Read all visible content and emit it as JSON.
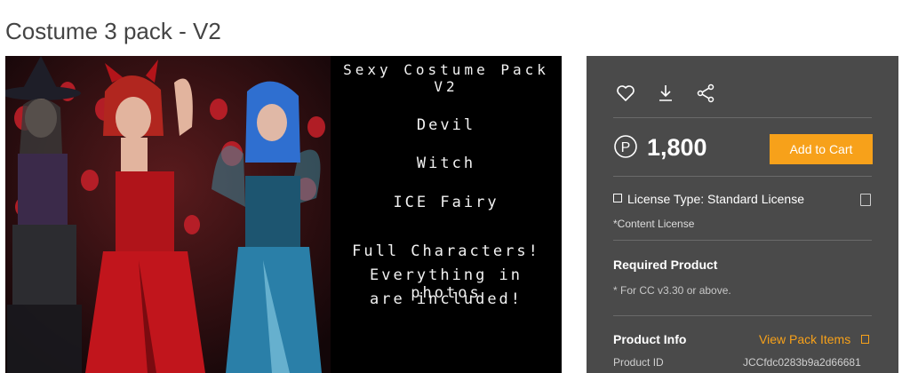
{
  "page": {
    "title": "Costume 3 pack - V2"
  },
  "hero": {
    "title": "Sexy Costume Pack V2",
    "line_devil": "Devil",
    "line_witch": "Witch",
    "line_ice": "ICE Fairy",
    "line_full": "Full Characters!",
    "line_every": "Everything in photos",
    "line_included": "are included!"
  },
  "panel": {
    "icons": [
      "heart-icon",
      "download-icon",
      "share-icon"
    ],
    "price": "1,800",
    "price_currency_symbol": "P",
    "add_to_cart": "Add to Cart",
    "license_label": "License Type: Standard License",
    "license_sub": "*Content License",
    "required_title": "Required Product",
    "required_sub": "* For CC v3.30 or above.",
    "product_info_title": "Product Info",
    "view_pack_items": "View Pack Items",
    "product_id_label": "Product ID",
    "product_id_value": "JCCfdc0283b9a2d66681"
  },
  "colors": {
    "accent": "#f7a11a",
    "panel_bg": "#4a4a4a"
  }
}
